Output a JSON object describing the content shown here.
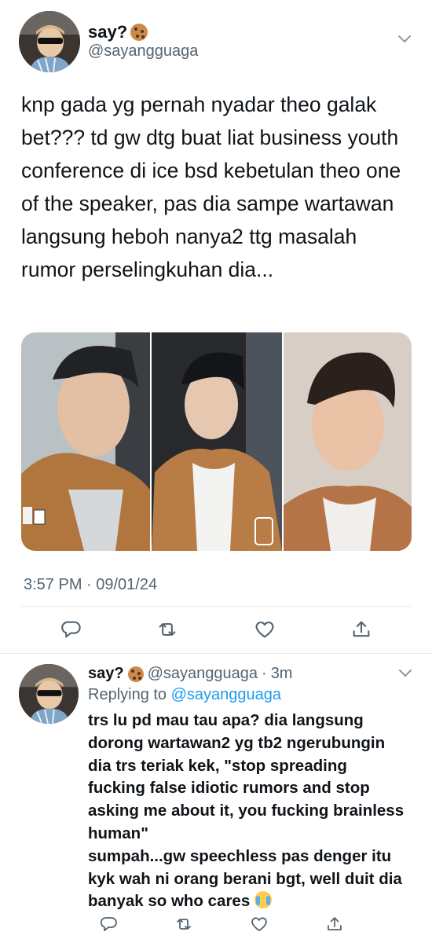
{
  "main_tweet": {
    "author": {
      "name": "say?",
      "name_emoji": "cookie-emoji",
      "handle": "@sayangguaga"
    },
    "text": "knp gada yg pernah nyadar theo galak bet??? td gw dtg buat liat business youth conference di ice bsd kebetulan theo one of the speaker, pas dia sampe wartawan langsung heboh nanya2 ttg masalah rumor perselingkuhan dia...",
    "media_count": 3,
    "timestamp": "3:57 PM · 09/01/24",
    "actions": [
      "reply-icon",
      "retweet-icon",
      "like-icon",
      "share-icon"
    ]
  },
  "reply_tweet": {
    "author": {
      "name": "say?",
      "name_emoji": "cookie-emoji",
      "handle": "@sayangguaga",
      "time": "3m"
    },
    "replying_label": "Replying to",
    "replying_mention": "@sayangguaga",
    "lines": [
      "trs lu pd mau tau apa? dia langsung",
      "dorong wartawan2 yg tb2 ngerubungin",
      "dia trs teriak kek, \"stop spreading",
      "fucking false idiotic rumors and stop",
      "asking me about it, you fucking brainless",
      "human\"",
      "sumpah...gw speechless pas denger itu",
      "kyk wah ni orang berani bgt, well duit dia",
      "banyak so who cares"
    ],
    "end_emoji": "loudly-crying-face-emoji",
    "actions": [
      "reply-icon",
      "retweet-icon",
      "like-icon",
      "share-icon"
    ]
  },
  "colors": {
    "text": "#0f1419",
    "secondary": "#536471",
    "link": "#1d9bf0",
    "divider": "#e6e9eb"
  }
}
